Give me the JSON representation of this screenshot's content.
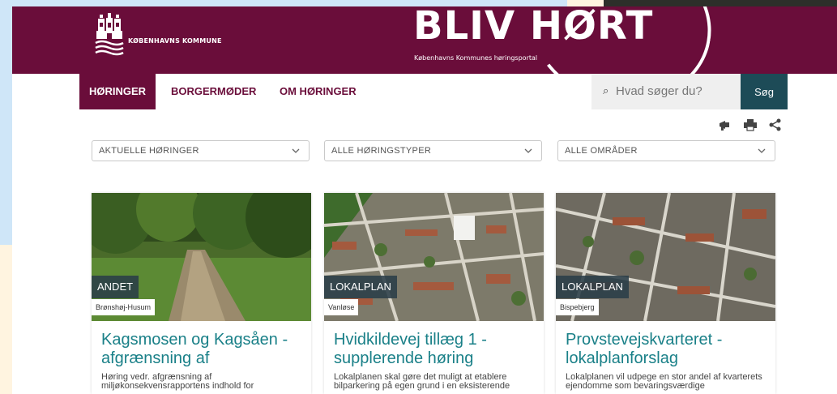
{
  "header": {
    "municipality_name": "KØBENHAVNS KOMMUNE",
    "portal_title": "BLIV HØRT",
    "portal_subtitle": "Københavns Kommunes høringsportal"
  },
  "nav": {
    "items": [
      {
        "label": "HØRINGER",
        "active": true
      },
      {
        "label": "BORGERMØDER",
        "active": false
      },
      {
        "label": "OM HØRINGER",
        "active": false
      }
    ]
  },
  "search": {
    "placeholder": "Hvad søger du?",
    "button_label": "Søg"
  },
  "tools": [
    "megaphone-icon",
    "print-icon",
    "share-icon"
  ],
  "filters": [
    {
      "label": "AKTUELLE HØRINGER"
    },
    {
      "label": "ALLE HØRINGSTYPER"
    },
    {
      "label": "ALLE OMRÅDER"
    }
  ],
  "cards": [
    {
      "type": "ANDET",
      "area": "Brønshøj-Husum",
      "title": "Kagsmosen og Kagsåen - afgrænsning af",
      "description": "Høring vedr. afgrænsning af miljøkonsekvensrapportens indhold for"
    },
    {
      "type": "LOKALPLAN",
      "area": "Vanløse",
      "title": "Hvidkildevej tillæg 1 - supplerende høring",
      "description": "Lokalplanen skal gøre det muligt at etablere bilparkering på egen grund i en eksisterende"
    },
    {
      "type": "LOKALPLAN",
      "area": "Bispebjerg",
      "title": "Provstevejskvarteret - lokalplanforslag",
      "description": "Lokalplanen vil udpege en stor andel af kvarterets ejendomme som bevaringsværdige"
    }
  ],
  "colors": {
    "brand": "#6a0d3a",
    "search_button": "#1d4b57",
    "title_teal": "#1a8088",
    "tag_bg": "#2a3e48"
  }
}
